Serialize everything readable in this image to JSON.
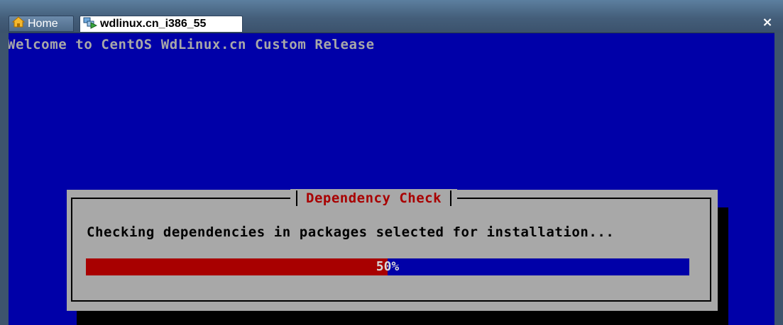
{
  "tabs": [
    {
      "label": "Home",
      "icon": "home-icon"
    },
    {
      "label": "wdlinux.cn_i386_55",
      "icon": "vm-icon",
      "active": true
    }
  ],
  "close_label": "×",
  "console": {
    "welcome": "Welcome to CentOS WdLinux.cn Custom Release",
    "background": "#0000a8"
  },
  "dialog": {
    "title": "Dependency Check",
    "message": "Checking dependencies in packages selected for installation...",
    "progress": {
      "percent": 50,
      "label": "50%",
      "fill_color": "#a80000",
      "track_color": "#0000a8"
    }
  }
}
